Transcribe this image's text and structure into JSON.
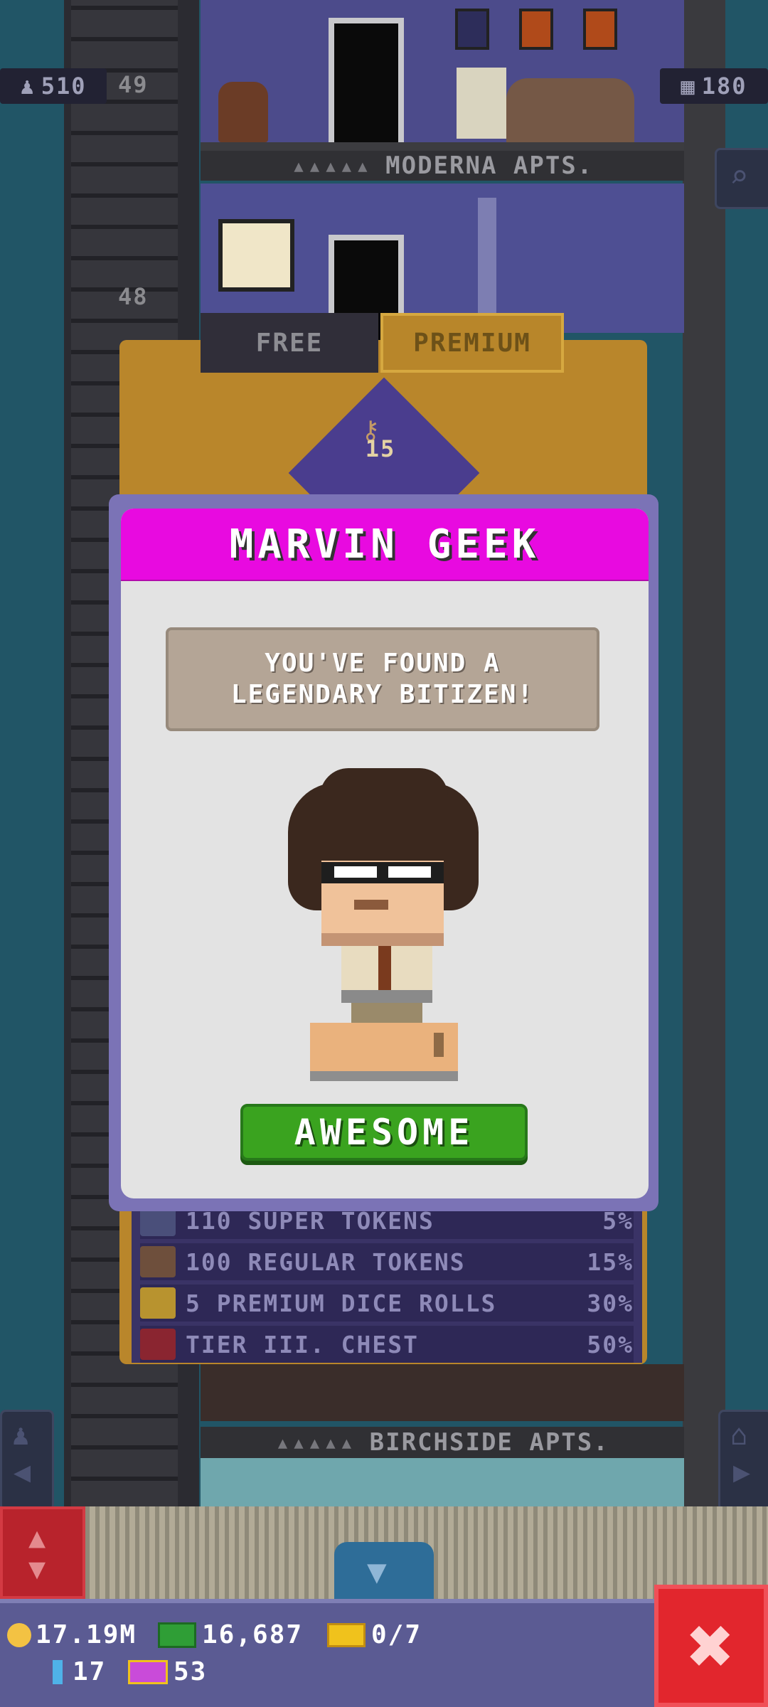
{
  "top_bar": {
    "population": "510",
    "floor_count": "180"
  },
  "floors": {
    "upper_number": "49",
    "second_number": "48",
    "upper_label": "MODERNA APTS.",
    "lower_label": "BIRCHSIDE APTS."
  },
  "tabs": {
    "free_label": "FREE",
    "premium_label": "PREMIUM"
  },
  "reward_tier": {
    "key_count": "15"
  },
  "reward_list": [
    {
      "label": "110 SUPER TOKENS",
      "percent": "5%",
      "icon": "super-token-icon"
    },
    {
      "label": "100 REGULAR TOKENS",
      "percent": "15%",
      "icon": "key-icon"
    },
    {
      "label": "5 PREMIUM DICE ROLLS",
      "percent": "30%",
      "icon": "dice-icon"
    },
    {
      "label": "TIER III. CHEST",
      "percent": "50%",
      "icon": "chest-icon"
    }
  ],
  "dialog": {
    "title": "MARVIN GEEK",
    "message_line1": "YOU'VE FOUND A",
    "message_line2": "LEGENDARY BITIZEN!",
    "button_label": "AWESOME"
  },
  "status_bar": {
    "coins": "17.19M",
    "bux": "16,687",
    "tickets": "0/7",
    "keys": "17",
    "golden_tickets": "53"
  },
  "colors": {
    "dialog_header": "#e80ae0",
    "button_green": "#3aa31f",
    "close_red": "#e2262d",
    "premium_gold": "#b8862a"
  }
}
